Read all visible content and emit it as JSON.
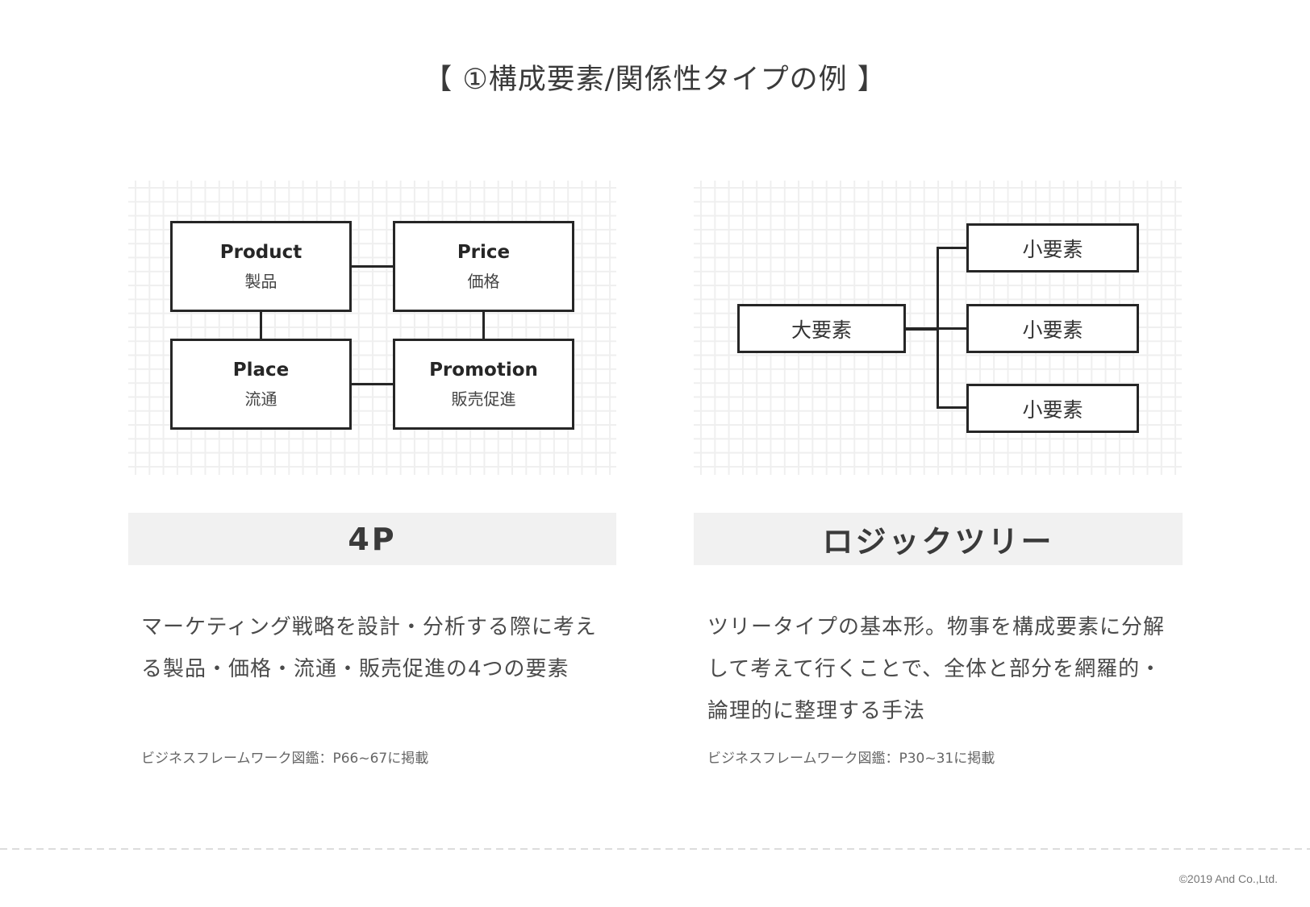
{
  "title": "【 ①構成要素/関係性タイプの例 】",
  "left": {
    "diagram": {
      "boxes": [
        {
          "en": "Product",
          "ja": "製品"
        },
        {
          "en": "Price",
          "ja": "価格"
        },
        {
          "en": "Place",
          "ja": "流通"
        },
        {
          "en": "Promotion",
          "ja": "販売促進"
        }
      ]
    },
    "label": "4P",
    "description": "マーケティング戦略を設計・分析する際に考える製品・価格・流通・販売促進の4つの要素",
    "source": "ビジネスフレームワーク図鑑：P66~67に掲載"
  },
  "right": {
    "diagram": {
      "root": "大要素",
      "children": [
        "小要素",
        "小要素",
        "小要素"
      ]
    },
    "label": "ロジックツリー",
    "description": "ツリータイプの基本形。物事を構成要素に分解して考えて行くことで、全体と部分を網羅的・論理的に整理する手法",
    "source": "ビジネスフレームワーク図鑑：P30~31に掲載"
  },
  "footer": {
    "copyright": "©2019 And Co.,Ltd."
  }
}
